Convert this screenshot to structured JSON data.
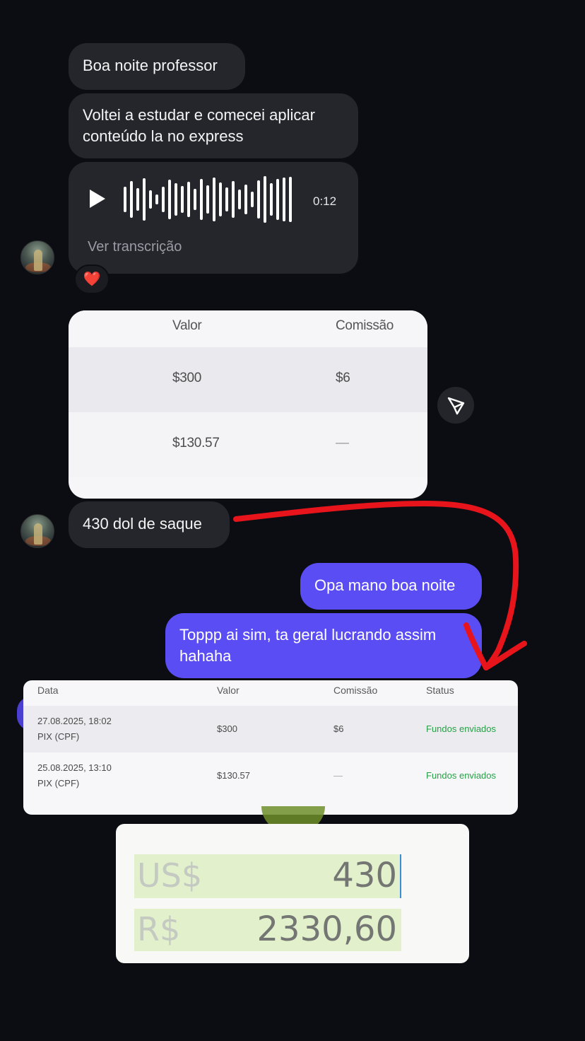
{
  "messages": {
    "m1": "Boa noite professor",
    "m2_line1": "Voltei a estudar e comecei aplicar",
    "m2_line2": "conteúdo la no express",
    "audio": {
      "duration": "0:12",
      "transcription_link": "Ver transcrição",
      "play_icon": "play-icon"
    },
    "reaction": "❤️",
    "m4": "430 dol de saque",
    "out1": "Opa mano boa noite",
    "out2_line1": "Toppp ai sim, ta geral lucrando assim",
    "out2_line2": "hahaha"
  },
  "shared_table": {
    "headers": [
      "Valor",
      "Comissão"
    ],
    "rows": [
      {
        "valor": "$300",
        "comissao": "$6"
      },
      {
        "valor": "$130.57",
        "comissao": "—"
      }
    ]
  },
  "share_icon": "paper-plane-icon",
  "withdrawals": {
    "headers": {
      "data": "Data",
      "valor": "Valor",
      "comissao": "Comissão",
      "status": "Status"
    },
    "rows": [
      {
        "date": "27.08.2025, 18:02",
        "method": "PIX (CPF)",
        "valor": "$300",
        "comissao": "$6",
        "status": "Fundos enviados"
      },
      {
        "date": "25.08.2025, 13:10",
        "method": "PIX (CPF)",
        "valor": "$130.57",
        "comissao": "—",
        "status": "Fundos enviados"
      }
    ]
  },
  "converter": {
    "from_label": "US$",
    "from_value": "430",
    "to_label": "R$",
    "to_value": "2330,60"
  },
  "colors": {
    "background": "#0c0d12",
    "incoming_bubble": "#25262c",
    "outgoing_bubble": "#5b4df4",
    "annotation_red": "#e8141c",
    "status_green": "#27a046"
  }
}
